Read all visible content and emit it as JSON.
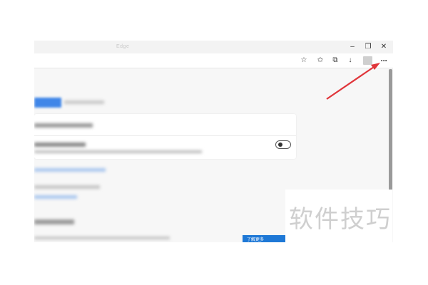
{
  "titlebar": {
    "title": "Edge",
    "minimize": "–",
    "restore": "❐",
    "close": "✕"
  },
  "toolbar": {
    "favorite": "☆",
    "favorites": "✩",
    "collections": "⧉",
    "download": "↓",
    "more": "···"
  },
  "content": {
    "accent_color": "#3f86e8",
    "toggle_state": "off",
    "learn_more_label": "了解更多"
  },
  "watermark": {
    "text": "软件技巧"
  },
  "annotation": {
    "arrow_color": "#e0353a"
  }
}
